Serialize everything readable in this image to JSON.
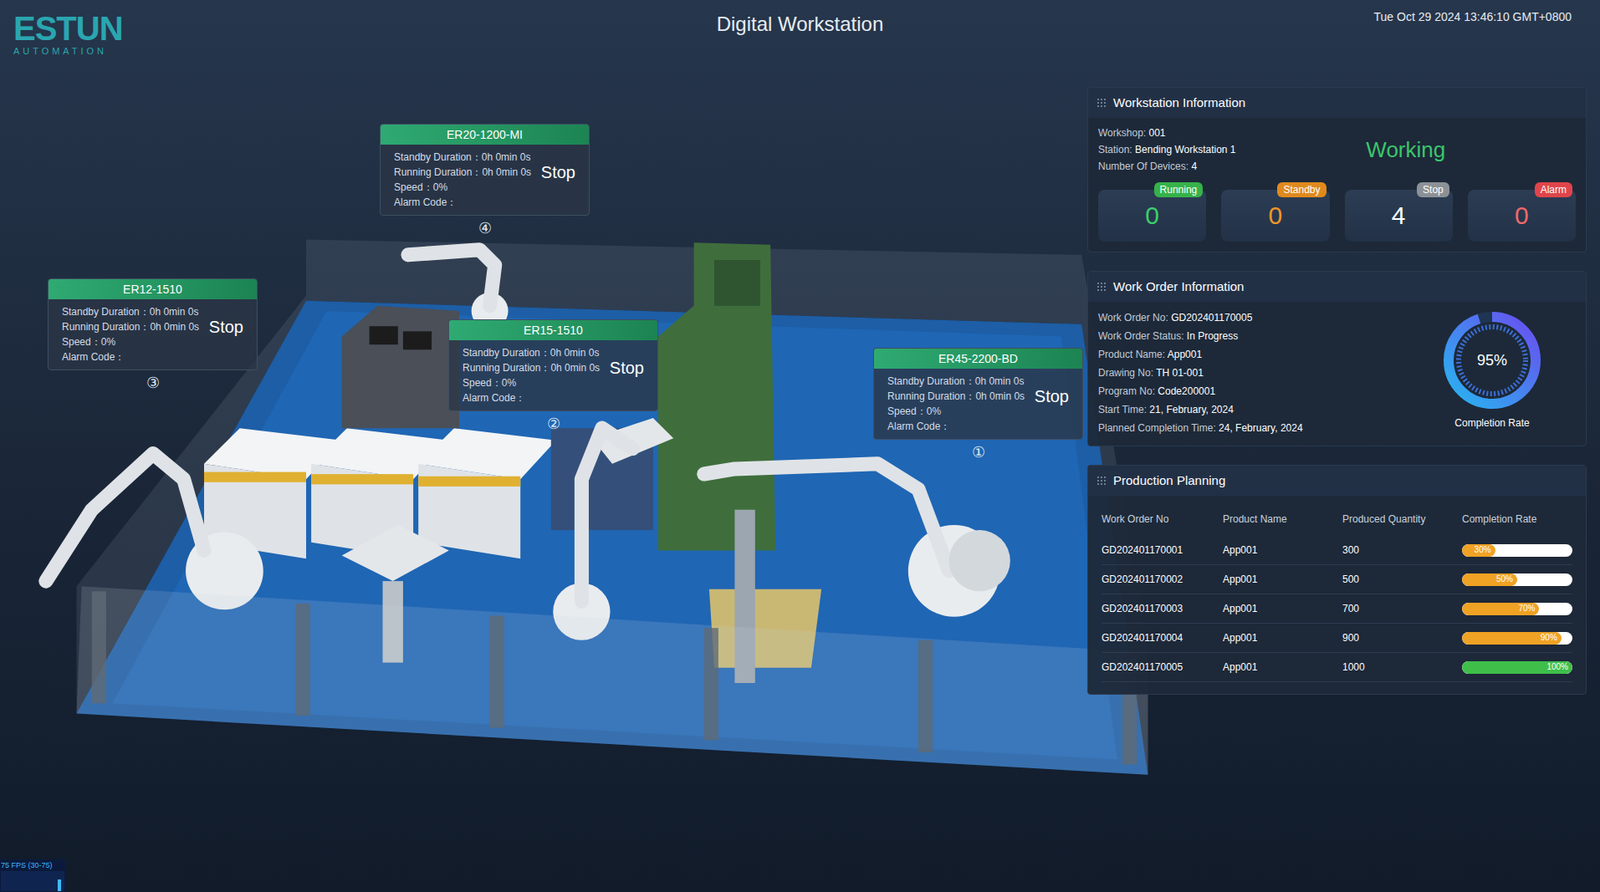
{
  "header": {
    "logo": "ESTUN",
    "logo_sub": "AUTOMATION",
    "title": "Digital Workstation",
    "datetime": "Tue Oct 29 2024 13:46:10 GMT+0800"
  },
  "devices": [
    {
      "name": "ER20-1200-MI",
      "marker": "④",
      "status": "Stop",
      "fields": [
        {
          "label": "Standby Duration：",
          "value": "0h 0min 0s"
        },
        {
          "label": "Running Duration：",
          "value": "0h 0min 0s"
        },
        {
          "label": "Speed：",
          "value": "0%"
        },
        {
          "label": "Alarm Code：",
          "value": ""
        }
      ]
    },
    {
      "name": "ER12-1510",
      "marker": "③",
      "status": "Stop",
      "fields": [
        {
          "label": "Standby Duration：",
          "value": "0h 0min 0s"
        },
        {
          "label": "Running Duration：",
          "value": "0h 0min 0s"
        },
        {
          "label": "Speed：",
          "value": "0%"
        },
        {
          "label": "Alarm Code：",
          "value": ""
        }
      ]
    },
    {
      "name": "ER15-1510",
      "marker": "②",
      "status": "Stop",
      "fields": [
        {
          "label": "Standby Duration：",
          "value": "0h 0min 0s"
        },
        {
          "label": "Running Duration：",
          "value": "0h 0min 0s"
        },
        {
          "label": "Speed：",
          "value": "0%"
        },
        {
          "label": "Alarm Code：",
          "value": ""
        }
      ]
    },
    {
      "name": "ER45-2200-BD",
      "marker": "①",
      "status": "Stop",
      "fields": [
        {
          "label": "Standby Duration：",
          "value": "0h 0min 0s"
        },
        {
          "label": "Running Duration：",
          "value": "0h 0min 0s"
        },
        {
          "label": "Speed：",
          "value": "0%"
        },
        {
          "label": "Alarm Code：",
          "value": ""
        }
      ]
    }
  ],
  "workstation": {
    "title": "Workstation Information",
    "fields": [
      {
        "label": "Workshop: ",
        "value": "001"
      },
      {
        "label": "Station: ",
        "value": "Bending Workstation 1"
      },
      {
        "label": "Number Of Devices: ",
        "value": "4"
      }
    ],
    "state": "Working",
    "counters": [
      {
        "label": "Running",
        "value": "0",
        "color": "#36b24a",
        "value_color": "#3ccf6a"
      },
      {
        "label": "Standby",
        "value": "0",
        "color": "#e08a1e",
        "value_color": "#f0962a"
      },
      {
        "label": "Stop",
        "value": "4",
        "color": "#8c9196",
        "value_color": "#ffffff"
      },
      {
        "label": "Alarm",
        "value": "0",
        "color": "#e0454a",
        "value_color": "#f0686a"
      }
    ]
  },
  "work_order": {
    "title": "Work Order Information",
    "fields": [
      {
        "label": "Work Order No: ",
        "value": "GD202401170005"
      },
      {
        "label": "Work Order Status: ",
        "value": "In Progress"
      },
      {
        "label": "Product Name: ",
        "value": "App001"
      },
      {
        "label": "Drawing No: ",
        "value": "TH 01-001"
      },
      {
        "label": "Program No: ",
        "value": "Code200001"
      },
      {
        "label": "Start Time: ",
        "value": "21, February, 2024"
      },
      {
        "label": "Planned Completion Time: ",
        "value": "24, February, 2024"
      }
    ],
    "completion": {
      "reading": "95%",
      "level": 0.95,
      "label": "Completion Rate"
    }
  },
  "planning": {
    "title": "Production Planning",
    "columns": [
      "Work Order No",
      "Product Name",
      "Produced Quantity",
      "Completion Rate"
    ],
    "rows": [
      {
        "cells": [
          "GD202401170001",
          "App001",
          "300"
        ],
        "rate": {
          "reading": "30%",
          "level": 0.3,
          "color": "#f0a224"
        }
      },
      {
        "cells": [
          "GD202401170002",
          "App001",
          "500"
        ],
        "rate": {
          "reading": "50%",
          "level": 0.5,
          "color": "#f0a224"
        }
      },
      {
        "cells": [
          "GD202401170003",
          "App001",
          "700"
        ],
        "rate": {
          "reading": "70%",
          "level": 0.7,
          "color": "#f0a224"
        }
      },
      {
        "cells": [
          "GD202401170004",
          "App001",
          "900"
        ],
        "rate": {
          "reading": "90%",
          "level": 0.9,
          "color": "#f0a224"
        }
      },
      {
        "cells": [
          "GD202401170005",
          "App001",
          "1000"
        ],
        "rate": {
          "reading": "100%",
          "level": 1,
          "color": "#3fbf4a"
        }
      }
    ]
  },
  "fps": "75 FPS (30-75)"
}
